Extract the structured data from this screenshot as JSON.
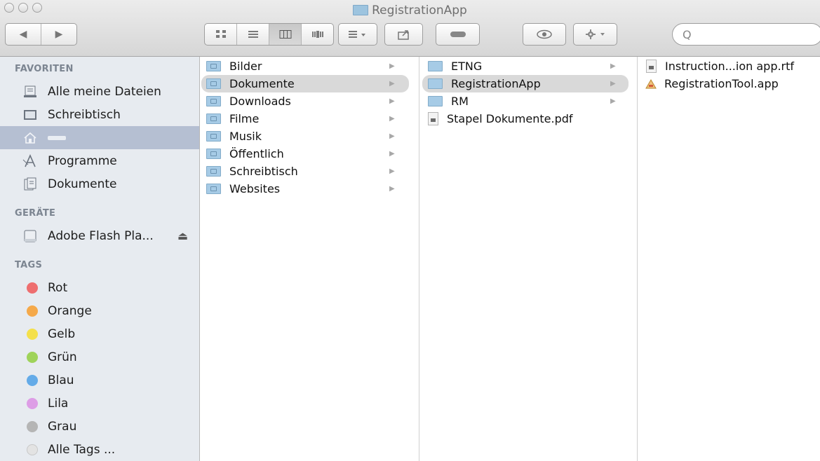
{
  "window": {
    "title": "RegistrationApp"
  },
  "toolbar": {
    "nav": [
      "◀",
      "▶"
    ],
    "view_modes": [
      "icon",
      "list",
      "column",
      "coverflow"
    ],
    "arrange_icon": "grid-arrange-icon",
    "share_icon": "share-icon",
    "tags_icon": "tag-icon",
    "quicklook_icon": "eye-icon",
    "action_icon": "gear-icon",
    "search_placeholder": "Q"
  },
  "sidebar": {
    "favorites_header": "FAVORITEN",
    "favorites": [
      {
        "label": "Alle meine Dateien",
        "icon": "all-files-icon"
      },
      {
        "label": "Schreibtisch",
        "icon": "desktop-icon"
      },
      {
        "label": "",
        "icon": "home-icon",
        "selected": true
      },
      {
        "label": "Programme",
        "icon": "applications-icon"
      },
      {
        "label": "Dokumente",
        "icon": "documents-icon"
      }
    ],
    "devices_header": "GERÄTE",
    "devices": [
      {
        "label": "Adobe Flash Pla...",
        "icon": "disk-icon"
      }
    ],
    "tags_header": "TAGS",
    "tags": [
      {
        "label": "Rot",
        "color": "#ee6e6f"
      },
      {
        "label": "Orange",
        "color": "#f5a94a"
      },
      {
        "label": "Gelb",
        "color": "#f4e04b"
      },
      {
        "label": "Grün",
        "color": "#9fd35a"
      },
      {
        "label": "Blau",
        "color": "#64abe8"
      },
      {
        "label": "Lila",
        "color": "#dd9de6"
      },
      {
        "label": "Grau",
        "color": "#b5b5b5"
      },
      {
        "label": "Alle Tags ...",
        "color": "#e3e3e3"
      }
    ]
  },
  "columns": {
    "col1": [
      "Bilder",
      "Dokumente",
      "Downloads",
      "Filme",
      "Musik",
      "Öffentlich",
      "Schreibtisch",
      "Websites"
    ],
    "col2": [
      "ETNG",
      "RegistrationApp",
      "RM",
      "Stapel Dokumente.pdf"
    ],
    "col3": [
      "Instruction...ion app.rtf",
      "RegistrationTool.app"
    ]
  }
}
